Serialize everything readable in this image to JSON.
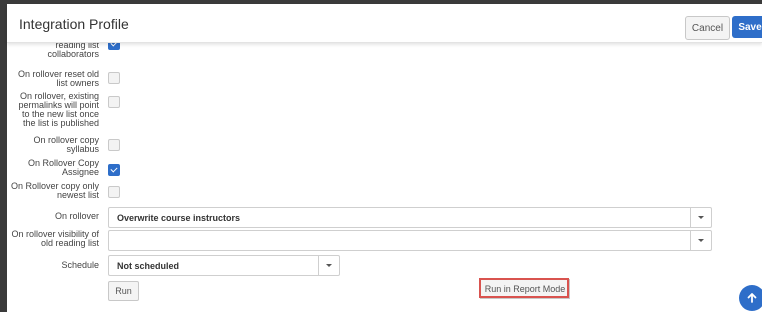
{
  "header": {
    "title": "Integration Profile",
    "cancel_label": "Cancel",
    "save_label": "Save"
  },
  "rows": {
    "copy_collaborators": {
      "label": "On rollover copy reading list collaborators",
      "visible_label": "reading list collaborators",
      "checked": true
    },
    "reset_owners": {
      "label": "On rollover reset old list owners",
      "checked": false
    },
    "permalinks": {
      "label": "On rollover, existing permalinks will point to the new list once the list is published",
      "checked": false
    },
    "copy_syllabus": {
      "label": "On rollover copy syllabus",
      "checked": false
    },
    "copy_assignee": {
      "label": "On Rollover Copy Assignee",
      "checked": true
    },
    "copy_newest": {
      "label": "On Rollover copy only newest list",
      "checked": false
    }
  },
  "on_rollover": {
    "label": "On rollover",
    "value": "Overwrite course instructors"
  },
  "visibility": {
    "label": "On rollover visibility of old reading list",
    "value": ""
  },
  "schedule": {
    "label": "Schedule",
    "value": "Not scheduled"
  },
  "actions": {
    "run_label": "Run",
    "report_label": "Run in Report Mode"
  },
  "colors": {
    "accent": "#2e6ec9",
    "highlight_outline": "#d9534f"
  }
}
